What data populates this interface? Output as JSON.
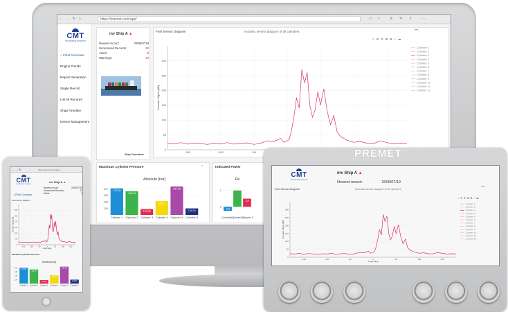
{
  "brand": {
    "logo_text": "CMT",
    "logo_sub": "monitoring systems",
    "premet": "PREMET",
    "registered": "®"
  },
  "browser": {
    "url": "https://premet.com/app/",
    "tablet_url": "https://premet.com/app/"
  },
  "sidebar": {
    "items": [
      {
        "label": "Fleet Overview",
        "active": true
      },
      {
        "label": "Engine Trends"
      },
      {
        "label": "Report Generation"
      },
      {
        "label": "Single Record"
      },
      {
        "label": "List All Records"
      },
      {
        "label": "Ships Timeline"
      },
      {
        "label": "Device Management"
      }
    ]
  },
  "ship": {
    "name": "mv Ship A",
    "newest_label": "Newest record:",
    "newest_value": "2009/07/19",
    "unresolved_label": "Unresolved Records:",
    "unresolved_value": "50",
    "alerts_label": "Alerts:",
    "alerts_value": "0",
    "warnings_label": "Warnings:",
    "warnings_value": "23",
    "overview_button": "Ship Overview"
  },
  "sensor": {
    "title": "Fuel Sensor Diagram",
    "subtitle": "Acoustic sensor diagram of all cylinders",
    "ylabel": "Acoustic Signal [dB]",
    "xlabel": "Angle [deg]",
    "legend": [
      "Cylinder 1",
      "Cylinder 2",
      "Cylinder 3",
      "Cylinder 4",
      "Cylinder 5",
      "Cylinder 6",
      "Cylinder 7",
      "Cylinder 8",
      "Cylinder 9",
      "Cylinder 10",
      "Cylinder 11",
      "Cylinder 12"
    ]
  },
  "pressure": {
    "title": "Maximum Cylinder Pressure",
    "chart_title": "Absolute [bar]"
  },
  "power": {
    "title": "Indicated Power",
    "chart_title_partial": "Re"
  },
  "chart_data": [
    {
      "type": "line",
      "title": "Acoustic sensor diagram of all cylinders",
      "xlabel": "Angle [deg]",
      "ylabel": "Acoustic Signal [dB]",
      "xlim": [
        -180,
        180
      ],
      "ylim": [
        0,
        350
      ],
      "xticks": [
        -150,
        -100,
        -50,
        0,
        50,
        100,
        150
      ],
      "yticks": [
        0,
        50,
        100,
        150,
        200,
        250,
        300
      ],
      "grid": true,
      "legend": "right",
      "series": [
        {
          "name": "Cylinder 3",
          "x": [
            -180,
            -170,
            -160,
            -150,
            -140,
            -130,
            -120,
            -110,
            -100,
            -90,
            -80,
            -70,
            -60,
            -50,
            -40,
            -30,
            -20,
            -10,
            -5,
            0,
            3,
            6,
            10,
            14,
            18,
            22,
            26,
            30,
            34,
            38,
            42,
            46,
            50,
            55,
            60,
            65,
            70,
            75,
            80,
            90,
            100,
            110,
            120,
            130,
            140,
            150,
            160,
            170,
            180
          ],
          "y": [
            22,
            20,
            24,
            19,
            23,
            21,
            18,
            22,
            20,
            24,
            19,
            22,
            23,
            18,
            22,
            30,
            28,
            38,
            25,
            30,
            35,
            60,
            110,
            175,
            140,
            270,
            225,
            260,
            150,
            110,
            135,
            195,
            150,
            205,
            130,
            85,
            115,
            60,
            45,
            32,
            25,
            28,
            22,
            21,
            30,
            24,
            20,
            22,
            21
          ]
        }
      ]
    },
    {
      "type": "bar",
      "title": "Absolute [bar]",
      "categories": [
        "Cylinder 1",
        "Cylinder 2",
        "Cylinder 3",
        "Cylinder 4",
        "Cylinder 5",
        "Cylinder 6"
      ],
      "values": [
        137.08,
        136.64,
        133.89,
        135.12,
        137.36,
        134.0
      ],
      "labels": [
        "137.08",
        "136.64",
        "133.89",
        "135.12",
        "137.36",
        "134.00"
      ],
      "colors": [
        "#1e8fd6",
        "#3cb44b",
        "#e02c54",
        "#f5d90a",
        "#a94aa8",
        "#21307f"
      ],
      "ylim": [
        133,
        138
      ],
      "yticks": [
        134,
        135,
        136,
        137
      ]
    },
    {
      "type": "bar",
      "title": "Re",
      "categories": [
        "Cylinder 1",
        "Cylinder 2",
        "Cylinder 3"
      ],
      "values": [
        -0.5,
        2.0,
        1.0
      ],
      "labels": [
        "-0.5",
        "",
        "1.8"
      ],
      "colors": [
        "#1e8fd6",
        "#3cb44b",
        "#e02c54"
      ],
      "ylim": [
        -1,
        3
      ],
      "yticks": [
        0,
        2
      ]
    }
  ]
}
